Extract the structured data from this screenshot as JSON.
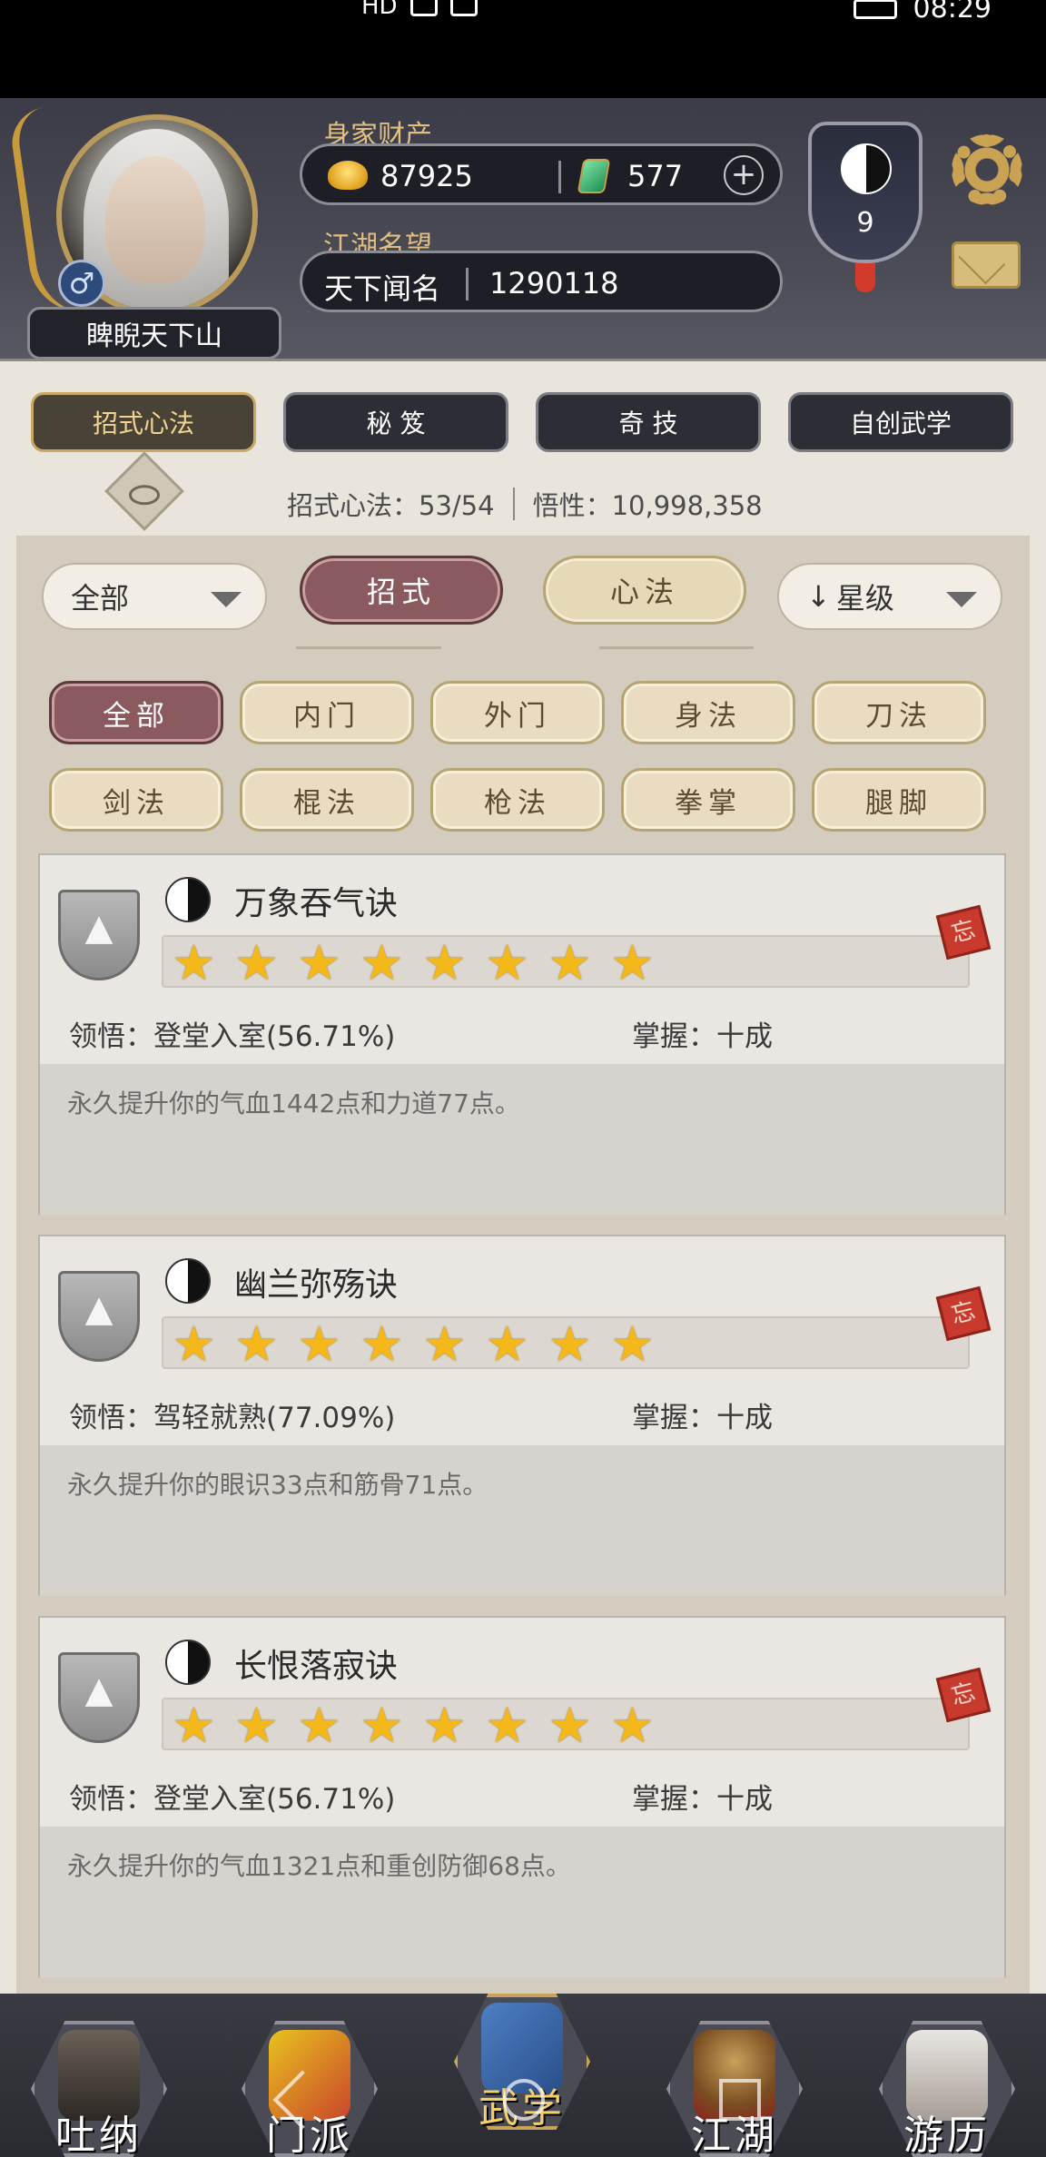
{
  "status_bar": {
    "left_icons": [
      "HD",
      "signal",
      "wifi"
    ],
    "time": "08:29"
  },
  "header": {
    "player_name": "睥睨天下山",
    "gender_symbol": "♂",
    "wealth_label": "身家财产",
    "gold": "87925",
    "jade": "577",
    "plus": "+",
    "fame_label": "江湖名望",
    "fame_title": "天下闻名",
    "fame_value": "1290118",
    "level": "9"
  },
  "top_tabs": [
    {
      "label": "招式心法",
      "active": true
    },
    {
      "label": "秘 笈",
      "active": false
    },
    {
      "label": "奇 技",
      "active": false
    },
    {
      "label": "自创武学",
      "active": false
    }
  ],
  "stats": {
    "skills_label": "招式心法：53/54",
    "insight_label": "悟性：10,998,358"
  },
  "filters": {
    "category_dropdown": "全部",
    "segments": [
      {
        "label": "招式",
        "active": true
      },
      {
        "label": "心法",
        "active": false
      }
    ],
    "sort_dropdown": "星级",
    "sort_arrow": "↓",
    "chips": [
      {
        "label": "全部",
        "active": true
      },
      {
        "label": "内门",
        "active": false
      },
      {
        "label": "外门",
        "active": false
      },
      {
        "label": "身法",
        "active": false
      },
      {
        "label": "刀法",
        "active": false
      },
      {
        "label": "剑法",
        "active": false
      },
      {
        "label": "棍法",
        "active": false
      },
      {
        "label": "枪法",
        "active": false
      },
      {
        "label": "拳掌",
        "active": false
      },
      {
        "label": "腿脚",
        "active": false
      }
    ]
  },
  "skills": [
    {
      "name": "万象吞气诀",
      "stars": 8,
      "comprehension": "领悟：登堂入室(56.71%)",
      "mastery": "掌握：十成",
      "description": "永久提升你的气血1442点和力道77点。",
      "seal": "忘"
    },
    {
      "name": "幽兰弥殇诀",
      "stars": 8,
      "comprehension": "领悟：驾轻就熟(77.09%)",
      "mastery": "掌握：十成",
      "description": "永久提升你的眼识33点和筋骨71点。",
      "seal": "忘"
    },
    {
      "name": "长恨落寂诀",
      "stars": 8,
      "comprehension": "领悟：登堂入室(56.71%)",
      "mastery": "掌握：十成",
      "description": "永久提升你的气血1321点和重创防御68点。",
      "seal": "忘"
    }
  ],
  "bottom_nav": [
    {
      "label": "吐纳",
      "active": false
    },
    {
      "label": "门派",
      "active": false
    },
    {
      "label": "武学",
      "active": true
    },
    {
      "label": "江湖",
      "active": false
    },
    {
      "label": "游历",
      "active": false
    }
  ],
  "colors": {
    "accent": "#8b5a5f",
    "gold": "#e0bf80",
    "star": "#f5b81a"
  }
}
